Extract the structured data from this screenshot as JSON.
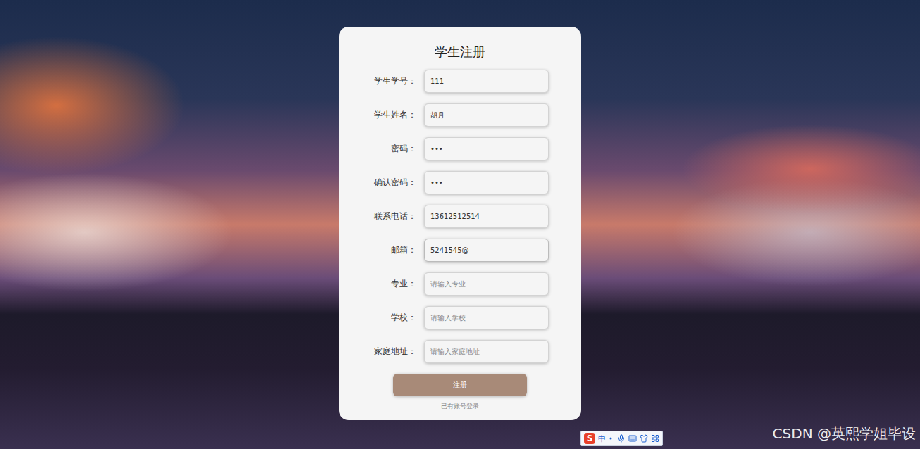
{
  "form": {
    "title": "学生注册",
    "fields": [
      {
        "label": "学生学号：",
        "value": "111",
        "placeholder": "",
        "focused": false
      },
      {
        "label": "学生姓名：",
        "value": "胡月",
        "placeholder": "",
        "focused": false
      },
      {
        "label": "密码：",
        "value": "•••",
        "placeholder": "",
        "focused": false
      },
      {
        "label": "确认密码：",
        "value": "•••",
        "placeholder": "",
        "focused": false
      },
      {
        "label": "联系电话：",
        "value": "13612512514",
        "placeholder": "",
        "focused": false
      },
      {
        "label": "邮箱：",
        "value": "5241545@",
        "placeholder": "",
        "focused": true
      },
      {
        "label": "专业：",
        "value": "",
        "placeholder": "请输入专业",
        "focused": false
      },
      {
        "label": "学校：",
        "value": "",
        "placeholder": "请输入学校",
        "focused": false
      },
      {
        "label": "家庭地址：",
        "value": "",
        "placeholder": "请输入家庭地址",
        "focused": false
      }
    ],
    "submit": "注册",
    "login_link": "已有账号登录"
  },
  "ime_toolbar": {
    "logo": "S",
    "mode": "中"
  },
  "watermark": "CSDN @英熙学姐毕设"
}
